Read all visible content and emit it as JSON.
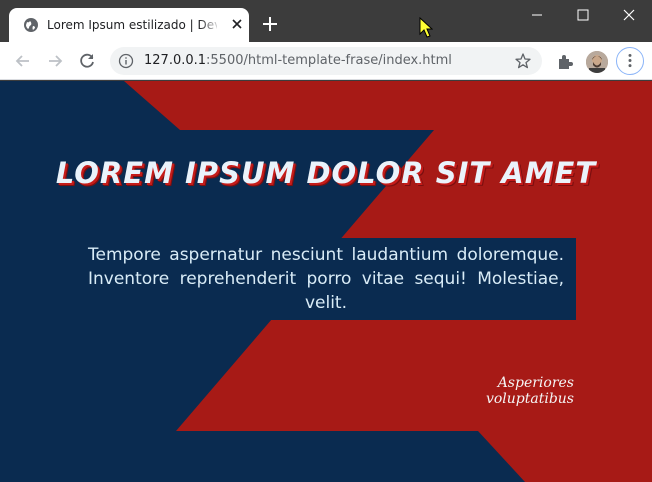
{
  "browser": {
    "tab": {
      "title": "Lorem Ipsum estilizado | Dev Web",
      "favicon": "globe-icon"
    },
    "new_tab_icon": "plus-icon",
    "window_controls": [
      "minimize-icon",
      "maximize-icon",
      "close-icon"
    ],
    "address": {
      "host": "127.0.0.1",
      "rest": ":5500/html-template-frase/index.html"
    }
  },
  "page": {
    "heading": "LOREM IPSUM DOLOR SIT AMET",
    "paragraph": "Tempore aspernatur nesciunt laudantium doloremque. Inventore reprehenderit porro vitae sequi! Molestiae, velit.",
    "signature": "Asperiores voluptatibus"
  },
  "colors": {
    "navy": "#0a2b50",
    "red": "#a71a16",
    "text": "#d9ecf7",
    "chrome_frame": "#3c3c3c"
  }
}
